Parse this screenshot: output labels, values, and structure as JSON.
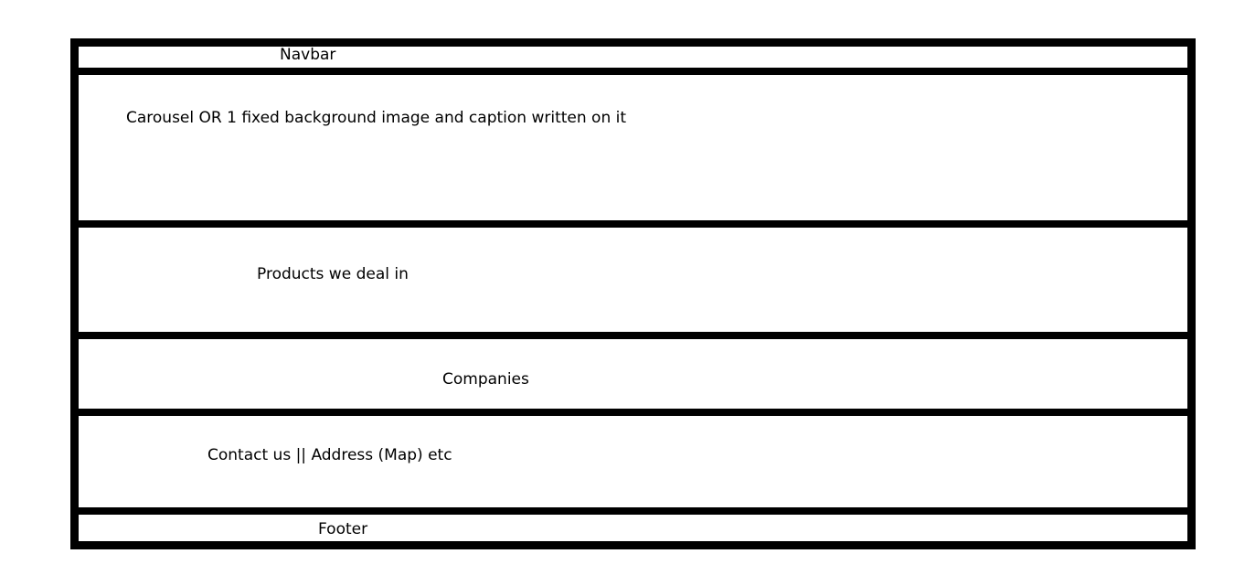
{
  "sections": {
    "navbar": "Navbar",
    "carousel": "Carousel OR 1 fixed background image and caption written on it",
    "products": "Products we deal in",
    "companies": "Companies",
    "contact": "Contact us || Address (Map) etc",
    "footer": "Footer"
  }
}
